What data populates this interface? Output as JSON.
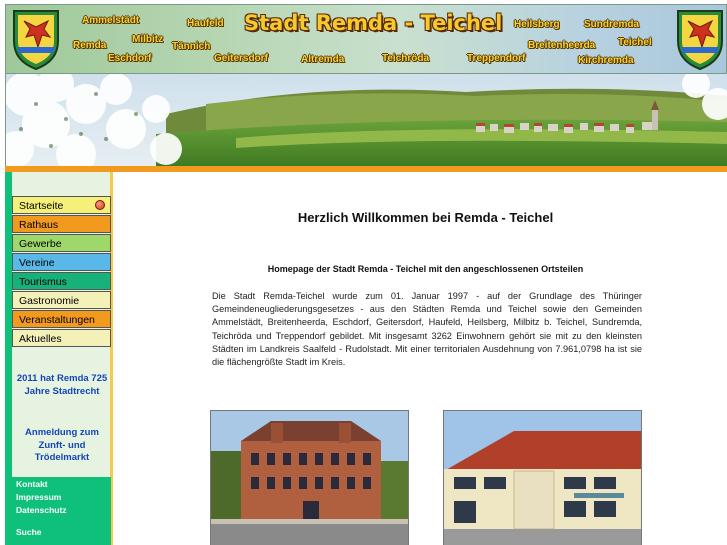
{
  "header": {
    "title": "Stadt Remda - Teichel",
    "places": {
      "ammelstaedt": "Ammelstädt",
      "haufeld": "Haufeld",
      "heilsberg": "Heilsberg",
      "sundremda": "Sundremda",
      "remda": "Remda",
      "milbitz": "Milbitz",
      "taennich": "Tännich",
      "breitenheerda": "Breitenheerda",
      "teichel": "Teichel",
      "eschdorf": "Eschdorf",
      "geitersdorf": "Geitersdorf",
      "altremda": "Altremda",
      "teichroeda": "Teichröda",
      "treppendorf": "Treppendorf",
      "kirchremda": "Kirchremda"
    },
    "crest_icon": "coat-of-arms-icon"
  },
  "sidebar": {
    "nav": [
      {
        "label": "Startseite",
        "color": "#f5f07a",
        "active": true
      },
      {
        "label": "Rathaus",
        "color": "#f29a1e"
      },
      {
        "label": "Gewerbe",
        "color": "#9fd86a"
      },
      {
        "label": "Vereine",
        "color": "#5ab8e8"
      },
      {
        "label": "Tourismus",
        "color": "#16b27a"
      },
      {
        "label": "Gastronomie",
        "color": "#f3f0b8"
      },
      {
        "label": "Veranstaltungen",
        "color": "#f29a1e"
      },
      {
        "label": "Aktuelles",
        "color": "#f3f0b8"
      }
    ],
    "anniversary_note": "2011 hat Remda 725 Jahre Stadtrecht",
    "market_note": "Anmeldung zum Zunft- und Trödelmarkt",
    "footer": {
      "kontakt": "Kontakt",
      "impressum": "Impressum",
      "datenschutz": "Datenschutz",
      "suche": "Suche"
    }
  },
  "main": {
    "welcome_title": "Herzlich Willkommen bei Remda - Teichel",
    "homepage_subtitle": "Homepage der Stadt Remda - Teichel mit den angeschlossenen Ortsteilen",
    "intro": "Die Stadt Remda-Teichel wurde zum 01. Januar 1997 - auf der Grundlage des Thüringer Gemeindeneugliederungsgesetzes - aus den Städten Remda und Teichel sowie den Gemeinden Ammelstädt, Breitenheerda, Eschdorf, Geitersdorf, Haufeld, Heilsberg, Milbitz b. Teichel, Sundremda, Teichröda und Treppendorf gebildet. Mit insgesamt 3262 Einwohnern gehört sie mit zu den kleinsten Städten im Landkreis Saalfeld - Rudolstadt. Mit einer territorialen Ausdehnung von 7.961,0798 ha ist sie die flächengrößte Stadt im Kreis."
  },
  "colors": {
    "accent_orange": "#f29a1e",
    "sidebar_green": "#0ec07a",
    "link_blue": "#1446b8",
    "title_gold": "#f6c92c"
  }
}
